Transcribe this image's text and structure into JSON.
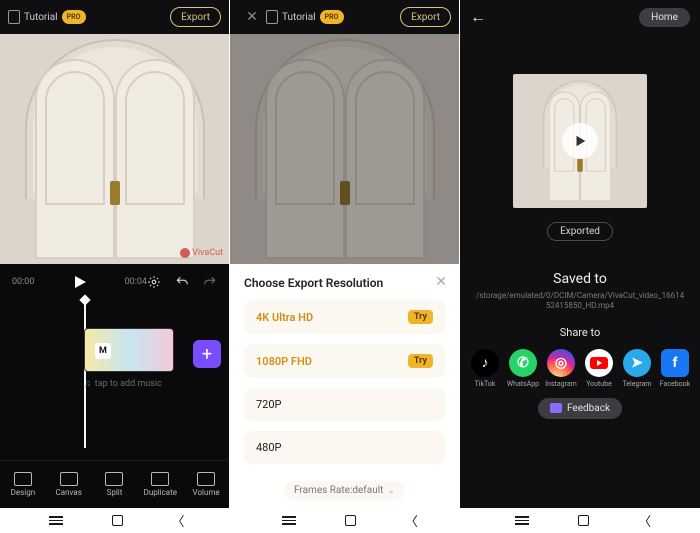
{
  "pane1": {
    "topbar": {
      "title": "Tutorial",
      "pro": "PRO",
      "export": "Export"
    },
    "watermark": "VivaCut",
    "controls": {
      "time_current": "00:00",
      "time_total": "00:04"
    },
    "timeline": {
      "clip_badge": "M",
      "music_hint": "tap to add music",
      "add": "+"
    },
    "tools": [
      {
        "label": "Design"
      },
      {
        "label": "Canvas"
      },
      {
        "label": "Split"
      },
      {
        "label": "Duplicate"
      },
      {
        "label": "Volume"
      }
    ]
  },
  "pane2": {
    "topbar": {
      "title": "Tutorial",
      "pro": "PRO",
      "export": "Export"
    },
    "modal": {
      "title": "Choose Export Resolution",
      "options": [
        {
          "label": "4K Ultra HD",
          "badge": "Try",
          "accent": true
        },
        {
          "label": "1080P FHD",
          "badge": "Try",
          "accent": true
        },
        {
          "label": "720P",
          "badge": null,
          "accent": false
        },
        {
          "label": "480P",
          "badge": null,
          "accent": false
        }
      ],
      "frames": "Frames Rate:default"
    }
  },
  "pane3": {
    "home": "Home",
    "exported": "Exported",
    "saved_label": "Saved to",
    "saved_path": "/storage/emulated/0/DCIM/Camera/VivaCut_video_1661452415850_HD.mp4",
    "share_label": "Share to",
    "share": [
      {
        "name": "TikTok",
        "cls": "c-tiktok",
        "glyph": "♪"
      },
      {
        "name": "WhatsApp",
        "cls": "c-wa",
        "glyph": "✆"
      },
      {
        "name": "Instagram",
        "cls": "c-ig",
        "glyph": "◎"
      },
      {
        "name": "Youtube",
        "cls": "c-yt",
        "glyph": ""
      },
      {
        "name": "Telegram",
        "cls": "c-tg",
        "glyph": "➤"
      },
      {
        "name": "Facebook",
        "cls": "c-fb",
        "glyph": "f"
      }
    ],
    "feedback": "Feedback"
  }
}
